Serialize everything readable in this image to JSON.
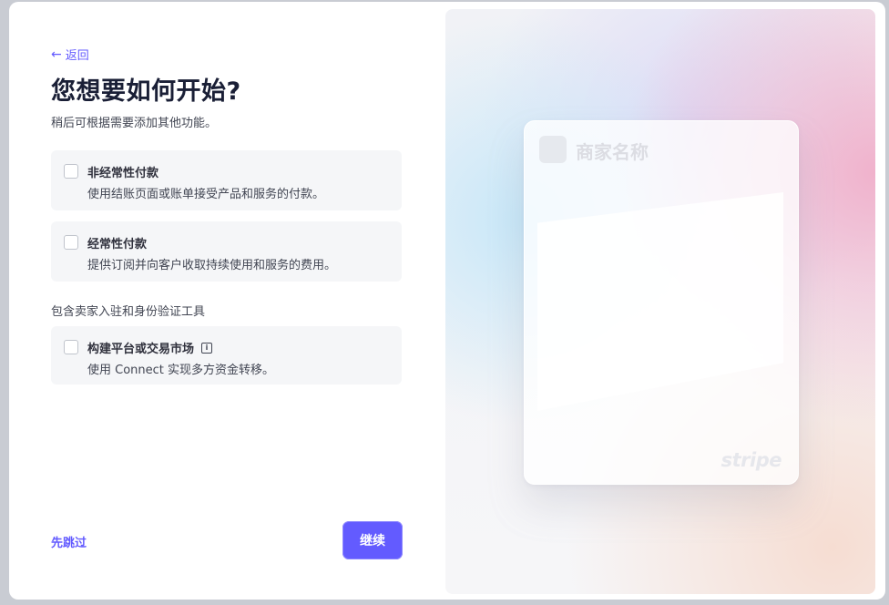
{
  "header": {
    "back_label": "返回",
    "title": "您想要如何开始?",
    "subtitle": "稍后可根据需要添加其他功能。"
  },
  "options": [
    {
      "title": "非经常性付款",
      "description": "使用结账页面或账单接受产品和服务的付款。",
      "checked": false
    },
    {
      "title": "经常性付款",
      "description": "提供订阅并向客户收取持续使用和服务的费用。",
      "checked": false
    }
  ],
  "section": {
    "label": "包含卖家入驻和身份验证工具"
  },
  "platform_option": {
    "title": "构建平台或交易市场",
    "info_icon": "i",
    "description": "使用 Connect 实现多方资金转移。",
    "checked": false
  },
  "footer": {
    "skip_label": "先跳过",
    "continue_label": "继续"
  },
  "preview": {
    "merchant_name": "商家名称",
    "brand": "stripe"
  },
  "colors": {
    "accent": "#635bff",
    "title": "#1a1f36",
    "option_bg": "#f5f6f8"
  }
}
